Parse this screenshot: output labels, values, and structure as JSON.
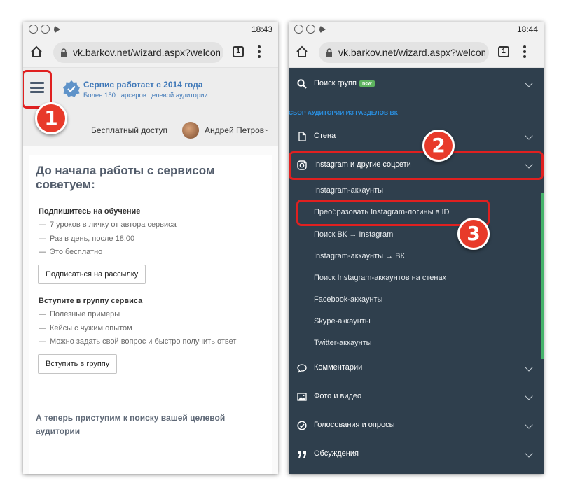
{
  "left_phone": {
    "status_time": "18:43",
    "url": "vk.barkov.net/wizard.aspx?welcome",
    "tab_count": "1",
    "header": {
      "title": "Сервис работает с 2014 года",
      "subtitle": "Более 150 парсеров целевой аудитории",
      "free_access": "Бесплатный доступ",
      "user_name": "Андрей Петров",
      "user_caret": "⌄"
    },
    "card": {
      "title": "До начала работы с сервисом советуем:",
      "section1_title": "Подпишитесь на обучение",
      "section1_items": [
        "7 уроков в личку от автора сервиса",
        "Раз в день, после 18:00",
        "Это бесплатно"
      ],
      "section1_button": "Подписаться на рассылку",
      "section2_title": "Вступите в группу сервиса",
      "section2_items": [
        "Полезные примеры",
        "Кейсы с чужим опытом",
        "Можно задать свой вопрос и быстро получить ответ"
      ],
      "section2_button": "Вступить в группу",
      "bottom_text": "А теперь приступим к поиску вашей целевой аудитории"
    },
    "callout_number": "1"
  },
  "right_phone": {
    "status_time": "18:44",
    "url": "vk.barkov.net/wizard.aspx?welcome",
    "tab_count": "1",
    "nav": {
      "search_groups": "Поиск групп",
      "new_badge": "new",
      "section_title": "СБОР АУДИТОРИИ ИЗ РАЗДЕЛОВ ВК",
      "wall": "Стена",
      "instagram": "Instagram и другие соцсети",
      "sub_items": [
        "Instagram-аккаунты",
        "Преобразовать Instagram-логины в ID",
        "Поиск ВК → Instagram",
        "Instagram-аккаунты → ВК",
        "Поиск Instagram-аккаунтов на стенах",
        "Facebook-аккаунты",
        "Skype-аккаунты",
        "Twitter-аккаунты"
      ],
      "comments": "Комментарии",
      "photo_video": "Фото и видео",
      "polls": "Голосования и опросы",
      "discussions": "Обсуждения"
    },
    "callout_numbers": [
      "2",
      "3"
    ]
  },
  "icons": {
    "status": [
      "viber-icon",
      "viber-icon",
      "play-store-icon"
    ],
    "toolbar": [
      "home-icon",
      "lock-icon",
      "tabs-icon",
      "more-vert-icon"
    ],
    "nav": [
      "search-icon",
      "document-icon",
      "instagram-icon",
      "comment-icon",
      "image-icon",
      "check-circle-icon",
      "quote-icon"
    ]
  },
  "colors": {
    "highlight_red": "#e02020",
    "callout_fill": "#e83a2a",
    "sidebar_bg": "#2f3f4d",
    "accent_blue": "#3f78b8",
    "section_blue": "#2a8fe0",
    "new_badge_green": "#5db35f",
    "scroll_green": "#45b36b"
  }
}
